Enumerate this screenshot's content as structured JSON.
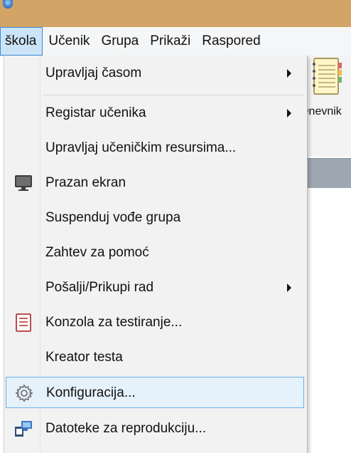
{
  "menubar": {
    "items": [
      {
        "label": "škola",
        "active": true
      },
      {
        "label": "Učenik",
        "active": false
      },
      {
        "label": "Grupa",
        "active": false
      },
      {
        "label": "Prikaži",
        "active": false
      },
      {
        "label": "Raspored",
        "active": false
      }
    ]
  },
  "background": {
    "toolbar_label": "Dnevnik"
  },
  "dropdown": {
    "items": [
      {
        "label": "Upravljaj časom",
        "submenu": true
      },
      {
        "label": "Registar učenika",
        "submenu": true
      },
      {
        "label": "Upravljaj učeničkim resursima...",
        "submenu": false
      },
      {
        "label": "Prazan ekran",
        "submenu": false,
        "icon": "monitor-icon"
      },
      {
        "label": "Suspenduj vođe grupa",
        "submenu": false
      },
      {
        "label": "Zahtev za pomoć",
        "submenu": false
      },
      {
        "label": "Pošalji/Prikupi rad",
        "submenu": true
      },
      {
        "label": "Konzola za testiranje...",
        "submenu": false,
        "icon": "test-console-icon"
      },
      {
        "label": "Kreator testa",
        "submenu": false
      },
      {
        "label": "Konfiguracija...",
        "submenu": false,
        "icon": "gear-icon",
        "highlighted": true
      },
      {
        "label": "Datoteke za reprodukciju...",
        "submenu": false,
        "icon": "replay-files-icon"
      }
    ]
  },
  "colors": {
    "title_bar": "#d2a466",
    "highlight_fill": "#e5f1fb",
    "highlight_border": "#6cb0e8",
    "menu_background": "#f2f2f2"
  }
}
